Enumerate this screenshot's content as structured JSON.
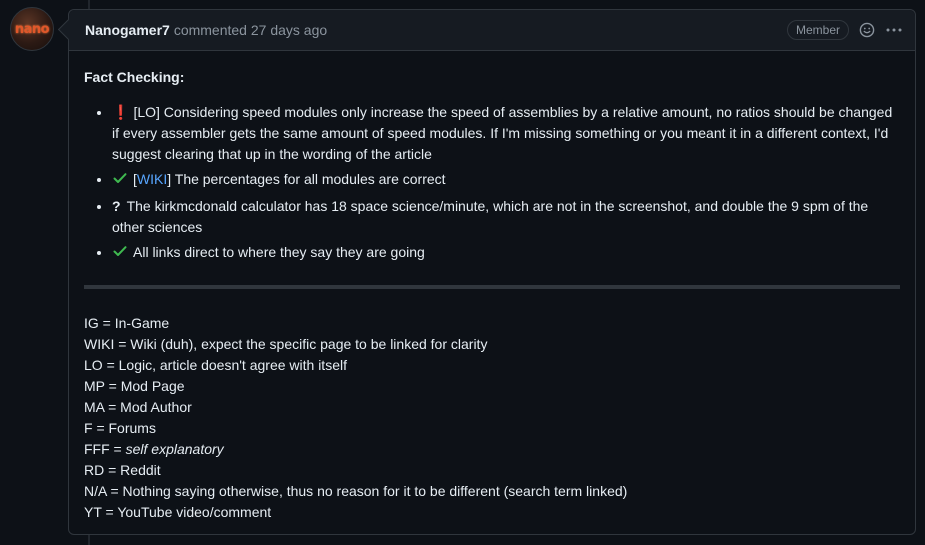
{
  "comment": {
    "author": "Nanogamer7",
    "action": "commented",
    "time": "27 days ago",
    "badge": "Member",
    "avatar_text": "nano"
  },
  "icons": {
    "avatar": "avatar-image",
    "reaction": "smiley-icon",
    "menu": "kebab-menu-icon",
    "exclamation": "exclamation-icon",
    "check": "check-icon",
    "question": "question-icon"
  },
  "colors": {
    "background": "#0d1117",
    "header_bg": "#161b22",
    "border": "#30363d",
    "text": "#e6edf3",
    "muted": "#8b949e",
    "link": "#58a6ff",
    "check": "#3fb950",
    "exclamation": "#f85149"
  },
  "body": {
    "title": "Fact Checking:",
    "items": [
      {
        "icon": "exclamation",
        "glyph": "❗",
        "tag": "[LO]",
        "text": " Considering speed modules only increase the speed of assemblies by a relative amount, no ratios should be changed if every assembler gets the same amount of speed modules. If I'm missing something or you meant it in a different context, I'd suggest clearing that up in the wording of the article"
      },
      {
        "icon": "check",
        "tag_prefix": "[",
        "link": "WIKI",
        "tag_suffix": "]",
        "text": " The percentages for all modules are correct"
      },
      {
        "icon": "question",
        "glyph": "?",
        "text": "The kirkmcdonald calculator has 18 space science/minute, which are not in the screenshot, and double the 9 spm of the other sciences"
      },
      {
        "icon": "check",
        "text": "All links direct to where they say they are going"
      }
    ],
    "legend": [
      "IG = In-Game",
      "WIKI = Wiki (duh), expect the specific page to be linked for clarity",
      "LO = Logic, article doesn't agree with itself",
      "MP = Mod Page",
      "MA = Mod Author",
      "F = Forums",
      {
        "prefix": "FFF = ",
        "italic": "self explanatory"
      },
      "RD = Reddit",
      "N/A = Nothing saying otherwise, thus no reason for it to be different (search term linked)",
      "YT = YouTube video/comment"
    ]
  }
}
